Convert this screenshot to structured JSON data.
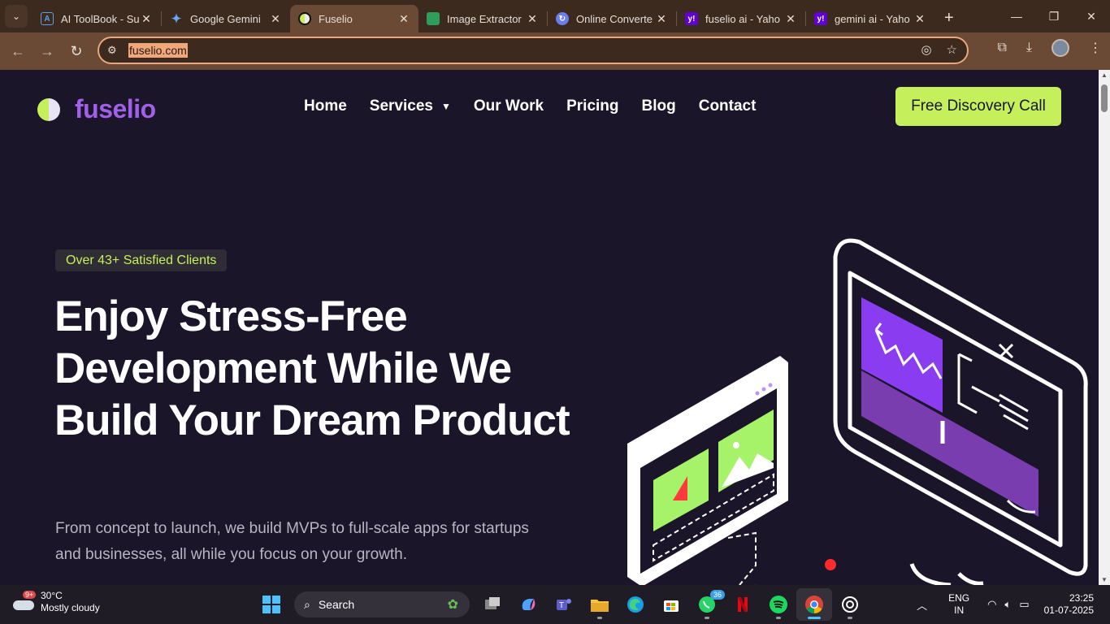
{
  "browser": {
    "tabs": [
      {
        "title": "AI ToolBook - Su",
        "favicon": "aitoolbook-icon",
        "active": false
      },
      {
        "title": "Google Gemini",
        "favicon": "gemini-icon",
        "active": false
      },
      {
        "title": "Fuselio",
        "favicon": "fuselio-icon",
        "active": true
      },
      {
        "title": "Image Extractor",
        "favicon": "image-extractor-icon",
        "active": false
      },
      {
        "title": "Online Converte",
        "favicon": "online-converter-icon",
        "active": false
      },
      {
        "title": "fuselio ai - Yaho",
        "favicon": "yahoo-icon",
        "active": false
      },
      {
        "title": "gemini ai - Yaho",
        "favicon": "yahoo-icon",
        "active": false
      }
    ],
    "url": "fuselio.com"
  },
  "site": {
    "logo_text": "fuselio",
    "nav": [
      "Home",
      "Services",
      "Our Work",
      "Pricing",
      "Blog",
      "Contact"
    ],
    "cta": "Free Discovery Call",
    "badge": "Over 43+ Satisfied Clients",
    "hero_title": "Enjoy Stress-Free Development While We Build Your Dream Product",
    "hero_subtitle": "From concept to launch, we build MVPs to full-scale apps for startups and businesses, all while you focus on your growth.",
    "colors": {
      "accent_green": "#c6f05b",
      "accent_purple": "#a160e8",
      "background": "#1a1528"
    }
  },
  "taskbar": {
    "weather_badge": "9+",
    "temperature": "30°C",
    "condition": "Mostly cloudy",
    "search_placeholder": "Search",
    "whatsapp_badge": "36",
    "language_1": "ENG",
    "language_2": "IN",
    "time": "23:25",
    "date": "01-07-2025"
  }
}
